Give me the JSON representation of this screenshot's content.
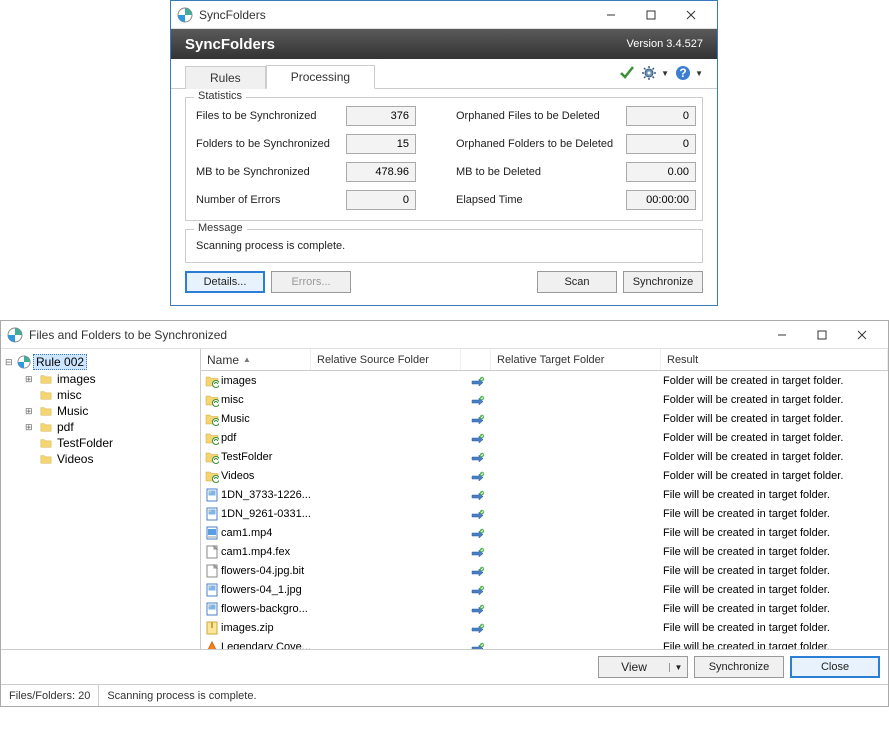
{
  "win1": {
    "title": "SyncFolders",
    "banner_title": "SyncFolders",
    "version": "Version 3.4.527",
    "tabs": {
      "rules": "Rules",
      "processing": "Processing"
    },
    "stats_title": "Statistics",
    "stats": {
      "files_sync_label": "Files to be Synchronized",
      "files_sync_val": "376",
      "folders_sync_label": "Folders to be Synchronized",
      "folders_sync_val": "15",
      "mb_sync_label": "MB to be Synchronized",
      "mb_sync_val": "478.96",
      "errors_label": "Number of Errors",
      "errors_val": "0",
      "orph_files_label": "Orphaned Files to be Deleted",
      "orph_files_val": "0",
      "orph_folders_label": "Orphaned Folders to be Deleted",
      "orph_folders_val": "0",
      "mb_del_label": "MB to be Deleted",
      "mb_del_val": "0.00",
      "elapsed_label": "Elapsed Time",
      "elapsed_val": "00:00:00"
    },
    "message_title": "Message",
    "message_text": "Scanning process is complete.",
    "buttons": {
      "details": "Details...",
      "errors": "Errors...",
      "scan": "Scan",
      "sync": "Synchronize"
    }
  },
  "win2": {
    "title": "Files and Folders to be Synchronized",
    "tree": {
      "root": "Rule 002",
      "children": [
        {
          "name": "images",
          "expandable": true
        },
        {
          "name": "misc",
          "expandable": false
        },
        {
          "name": "Music",
          "expandable": true
        },
        {
          "name": "pdf",
          "expandable": true
        },
        {
          "name": "TestFolder",
          "expandable": false
        },
        {
          "name": "Videos",
          "expandable": false
        }
      ]
    },
    "columns": {
      "name": "Name",
      "src": "Relative Source Folder",
      "tgt": "Relative Target Folder",
      "result": "Result"
    },
    "rows": [
      {
        "icon": "folder",
        "name": "images",
        "result": "Folder will be created in target folder."
      },
      {
        "icon": "folder",
        "name": "misc",
        "result": "Folder will be created in target folder."
      },
      {
        "icon": "folder",
        "name": "Music",
        "result": "Folder will be created in target folder."
      },
      {
        "icon": "folder",
        "name": "pdf",
        "result": "Folder will be created in target folder."
      },
      {
        "icon": "folder",
        "name": "TestFolder",
        "result": "Folder will be created in target folder."
      },
      {
        "icon": "folder",
        "name": "Videos",
        "result": "Folder will be created in target folder."
      },
      {
        "icon": "image",
        "name": "1DN_3733-1226...",
        "result": "File will be created in target folder."
      },
      {
        "icon": "image",
        "name": "1DN_9261-0331...",
        "result": "File will be created in target folder."
      },
      {
        "icon": "video",
        "name": "cam1.mp4",
        "result": "File will be created in target folder."
      },
      {
        "icon": "file",
        "name": "cam1.mp4.fex",
        "result": "File will be created in target folder."
      },
      {
        "icon": "file",
        "name": "flowers-04.jpg.bit",
        "result": "File will be created in target folder."
      },
      {
        "icon": "image",
        "name": "flowers-04_1.jpg",
        "result": "File will be created in target folder."
      },
      {
        "icon": "image",
        "name": "flowers-backgro...",
        "result": "File will be created in target folder."
      },
      {
        "icon": "zip",
        "name": "images.zip",
        "result": "File will be created in target folder."
      },
      {
        "icon": "media",
        "name": "Legendary Cove...",
        "result": "File will be created in target folder."
      }
    ],
    "footer": {
      "view": "View",
      "sync": "Synchronize",
      "close": "Close"
    },
    "status": {
      "count": "Files/Folders: 20",
      "msg": "Scanning process is complete."
    }
  }
}
